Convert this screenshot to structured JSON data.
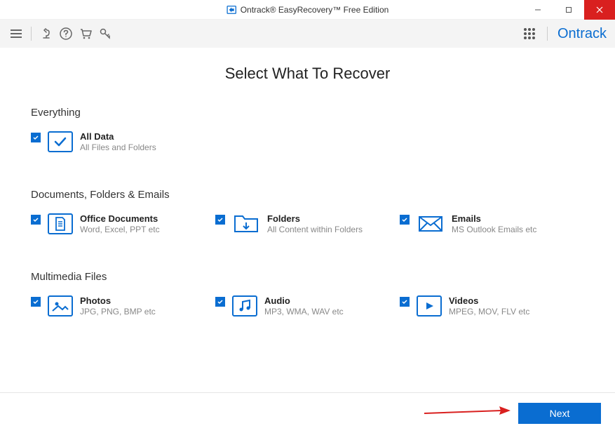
{
  "window": {
    "title": "Ontrack® EasyRecovery™ Free Edition"
  },
  "brand": "Ontrack",
  "page": {
    "title": "Select What To Recover"
  },
  "sections": {
    "everything": {
      "head": "Everything",
      "alldata": {
        "title": "All Data",
        "sub": "All Files and Folders"
      }
    },
    "docs": {
      "head": "Documents, Folders & Emails",
      "office": {
        "title": "Office Documents",
        "sub": "Word, Excel, PPT etc"
      },
      "folders": {
        "title": "Folders",
        "sub": "All Content within Folders"
      },
      "emails": {
        "title": "Emails",
        "sub": "MS Outlook Emails etc"
      }
    },
    "media": {
      "head": "Multimedia Files",
      "photos": {
        "title": "Photos",
        "sub": "JPG, PNG, BMP etc"
      },
      "audio": {
        "title": "Audio",
        "sub": "MP3, WMA, WAV etc"
      },
      "videos": {
        "title": "Videos",
        "sub": "MPEG, MOV, FLV etc"
      }
    }
  },
  "footer": {
    "next": "Next"
  }
}
